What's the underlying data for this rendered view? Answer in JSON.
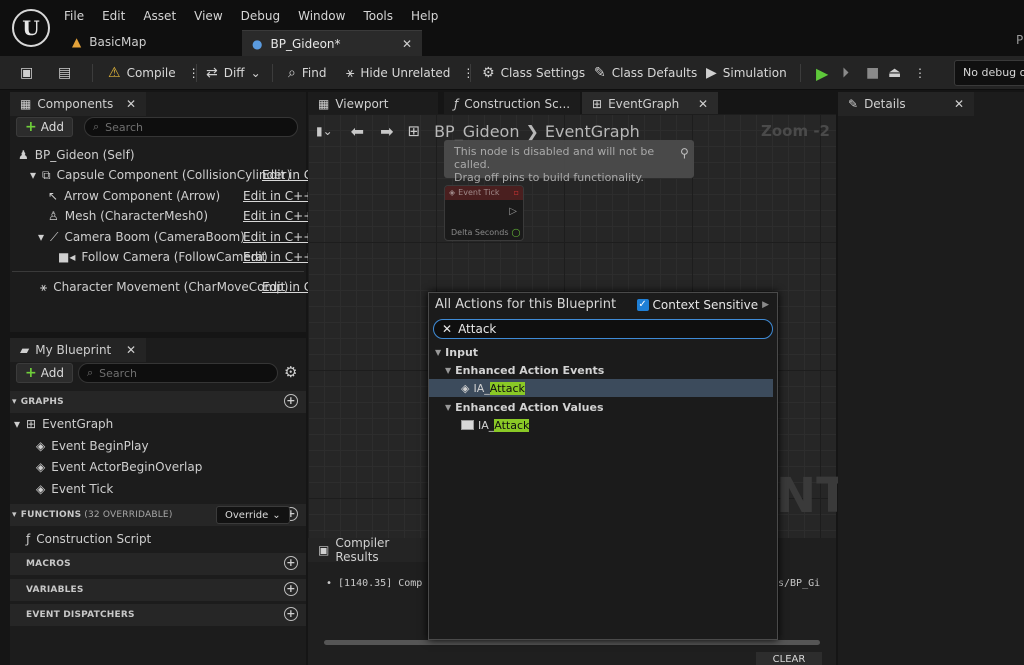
{
  "menu": [
    "File",
    "Edit",
    "Asset",
    "View",
    "Debug",
    "Window",
    "Tools",
    "Help"
  ],
  "tabs": [
    {
      "label": "BasicMap",
      "icon": "map-icon"
    },
    {
      "label": "BP_Gideon*",
      "icon": "pawn-icon"
    }
  ],
  "corner_letter": "P",
  "toolbar": {
    "compile": "Compile",
    "diff": "Diff",
    "find": "Find",
    "hide_unrelated": "Hide Unrelated",
    "class_settings": "Class Settings",
    "class_defaults": "Class Defaults",
    "simulation": "Simulation",
    "debug_select": "No debug object selected"
  },
  "components": {
    "tab": "Components",
    "add": "Add",
    "search_placeholder": "Search",
    "items": [
      {
        "label": "BP_Gideon (Self)"
      },
      {
        "label": "Capsule Component (CollisionCylinder)",
        "edit": "Edit in C"
      },
      {
        "label": "Arrow Component (Arrow)",
        "edit": "Edit in C++"
      },
      {
        "label": "Mesh (CharacterMesh0)",
        "edit": "Edit in C++"
      },
      {
        "label": "Camera Boom (CameraBoom)",
        "edit": "Edit in C++"
      },
      {
        "label": "Follow Camera (FollowCamera)",
        "edit": "Edit in C++"
      },
      {
        "label": "Character Movement (CharMoveComp)",
        "edit": "Edit in C"
      }
    ]
  },
  "my_blueprint": {
    "tab": "My Blueprint",
    "add": "Add",
    "search_placeholder": "Search",
    "graphs_label": "GRAPHS",
    "event_graph": "EventGraph",
    "events": [
      "Event BeginPlay",
      "Event ActorBeginOverlap",
      "Event Tick"
    ],
    "functions_label": "FUNCTIONS",
    "functions_count": "(32 OVERRIDABLE)",
    "override": "Override",
    "construction_script": "Construction Script",
    "macros": "MACROS",
    "variables": "VARIABLES",
    "event_dispatchers": "EVENT DISPATCHERS"
  },
  "center_tabs": [
    "Viewport",
    "Construction Sc...",
    "EventGraph"
  ],
  "breadcrumb": {
    "root": "BP_Gideon",
    "current": "EventGraph",
    "zoom": "Zoom -2"
  },
  "disabled_note": [
    "This node is disabled and will not be called.",
    "Drag off pins to build functionality."
  ],
  "event_tick_node": {
    "title": "Event Tick",
    "pin": "Delta Seconds"
  },
  "watermark": "NT",
  "details_tab": "Details",
  "popup": {
    "title": "All Actions for this Blueprint",
    "context_sensitive": "Context Sensitive",
    "query": "Attack",
    "category": "Input",
    "group1": "Enhanced Action Events",
    "group2": "Enhanced Action Values",
    "item_prefix": "IA_",
    "item_match": "Attack"
  },
  "compiler": {
    "tab": "Compiler Results",
    "line_start": "[1140.35] Comp",
    "line_end": "s/BP_Gi",
    "clear": "CLEAR"
  }
}
